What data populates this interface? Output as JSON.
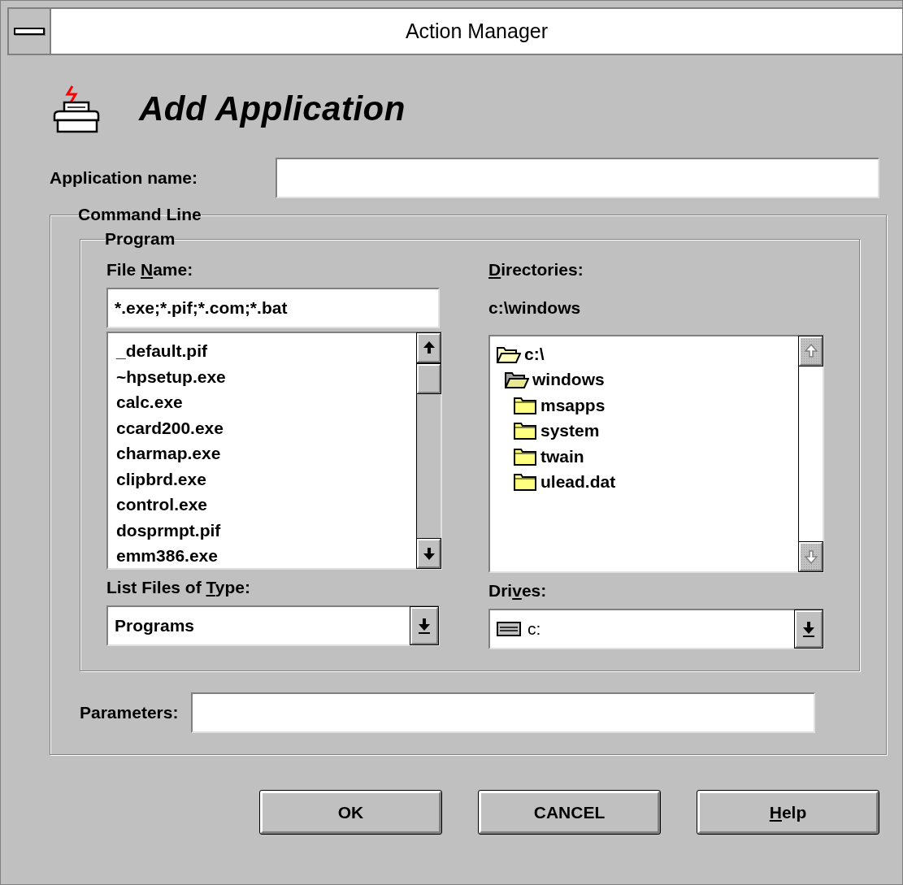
{
  "window": {
    "title": "Action Manager"
  },
  "heading": "Add Application",
  "application_name": {
    "label": "Application name:"
  },
  "command_line": {
    "title": "Command Line",
    "program": {
      "title": "Program",
      "file_name": {
        "label": [
          {
            "text": "File ",
            "underlined": false
          },
          {
            "text": "N",
            "underlined": true
          },
          {
            "text": "ame:",
            "underlined": false
          }
        ],
        "value": "*.exe;*.pif;*.com;*.bat"
      },
      "files": {
        "scrollbar_enabled": true,
        "items": [
          {
            "name": "_default.pif",
            "selected": false
          },
          {
            "name": "~hpsetup.exe",
            "selected": false
          },
          {
            "name": "calc.exe",
            "selected": false
          },
          {
            "name": "ccard200.exe",
            "selected": false
          },
          {
            "name": "charmap.exe",
            "selected": false
          },
          {
            "name": "clipbrd.exe",
            "selected": false
          },
          {
            "name": "control.exe",
            "selected": false
          },
          {
            "name": "dosprmpt.pif",
            "selected": false
          },
          {
            "name": "emm386.exe",
            "selected": false
          }
        ]
      },
      "file_type": {
        "label": [
          {
            "text": "List Files of ",
            "underlined": false
          },
          {
            "text": "T",
            "underlined": true
          },
          {
            "text": "ype:",
            "underlined": false
          }
        ],
        "value": "Programs"
      },
      "directories": {
        "label": [
          {
            "text": "D",
            "underlined": true
          },
          {
            "text": "irectories:",
            "underlined": false
          }
        ],
        "path": "c:\\windows",
        "scrollbar_enabled": false,
        "tree": [
          {
            "name": "c:\\",
            "selected": false,
            "children": [
              {
                "name": "windows",
                "selected": true,
                "children": [
                  {
                    "name": "msapps",
                    "selected": false
                  },
                  {
                    "name": "system",
                    "selected": false
                  },
                  {
                    "name": "twain",
                    "selected": false
                  },
                  {
                    "name": "ulead.dat",
                    "selected": false
                  }
                ]
              }
            ]
          }
        ]
      },
      "drives": {
        "label": [
          {
            "text": "Dri",
            "underlined": false
          },
          {
            "text": "v",
            "underlined": true
          },
          {
            "text": "es:",
            "underlined": false
          }
        ],
        "value": "c:"
      }
    },
    "parameters": {
      "label": "Parameters:"
    }
  },
  "buttons": [
    {
      "label": [
        {
          "text": "OK",
          "underlined": false
        }
      ]
    },
    {
      "label": [
        {
          "text": "CANCEL",
          "underlined": false
        }
      ]
    },
    {
      "label": [
        {
          "text": "H",
          "underlined": true
        },
        {
          "text": "elp",
          "underlined": false
        }
      ]
    }
  ]
}
